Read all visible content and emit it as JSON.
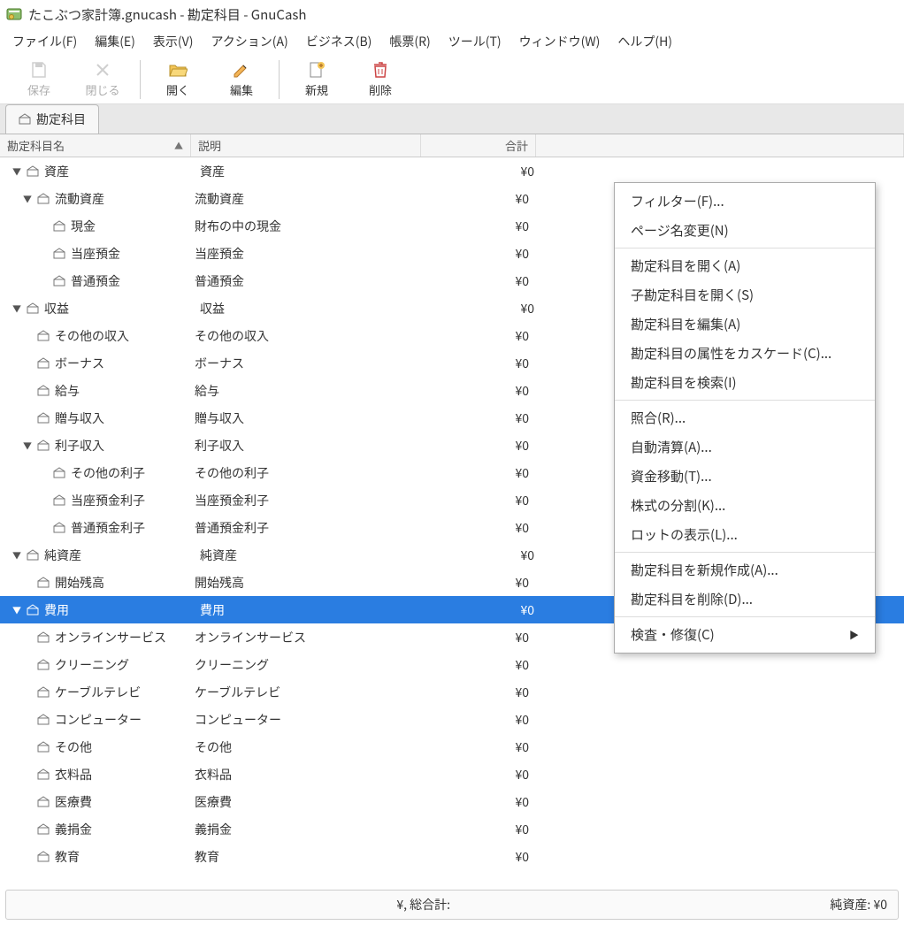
{
  "title": "たこぶつ家計簿.gnucash - 勘定科目 - GnuCash",
  "menu": {
    "file": "ファイル(F)",
    "edit": "編集(E)",
    "view": "表示(V)",
    "actions": "アクション(A)",
    "business": "ビジネス(B)",
    "reports": "帳票(R)",
    "tools": "ツール(T)",
    "windows": "ウィンドウ(W)",
    "help": "ヘルプ(H)"
  },
  "toolbar": {
    "save": "保存",
    "close": "閉じる",
    "open": "開く",
    "edit": "編集",
    "new": "新規",
    "delete": "削除"
  },
  "tab": {
    "label": "勘定科目"
  },
  "columns": {
    "name": "勘定科目名",
    "desc": "説明",
    "total": "合計"
  },
  "rows": [
    {
      "name": "資産",
      "desc": "資産",
      "total": "¥0",
      "depth": 0,
      "exp": "▼"
    },
    {
      "name": "流動資産",
      "desc": "流動資産",
      "total": "¥0",
      "depth": 1,
      "exp": "▼"
    },
    {
      "name": "現金",
      "desc": "財布の中の現金",
      "total": "¥0",
      "depth": 2,
      "exp": ""
    },
    {
      "name": "当座預金",
      "desc": "当座預金",
      "total": "¥0",
      "depth": 2,
      "exp": ""
    },
    {
      "name": "普通預金",
      "desc": "普通預金",
      "total": "¥0",
      "depth": 2,
      "exp": ""
    },
    {
      "name": "収益",
      "desc": "収益",
      "total": "¥0",
      "depth": 0,
      "exp": "▼"
    },
    {
      "name": "その他の収入",
      "desc": "その他の収入",
      "total": "¥0",
      "depth": 1,
      "exp": ""
    },
    {
      "name": "ボーナス",
      "desc": "ボーナス",
      "total": "¥0",
      "depth": 1,
      "exp": ""
    },
    {
      "name": "給与",
      "desc": "給与",
      "total": "¥0",
      "depth": 1,
      "exp": ""
    },
    {
      "name": "贈与収入",
      "desc": "贈与収入",
      "total": "¥0",
      "depth": 1,
      "exp": ""
    },
    {
      "name": "利子収入",
      "desc": "利子収入",
      "total": "¥0",
      "depth": 1,
      "exp": "▼"
    },
    {
      "name": "その他の利子",
      "desc": "その他の利子",
      "total": "¥0",
      "depth": 2,
      "exp": ""
    },
    {
      "name": "当座預金利子",
      "desc": "当座預金利子",
      "total": "¥0",
      "depth": 2,
      "exp": ""
    },
    {
      "name": "普通預金利子",
      "desc": "普通預金利子",
      "total": "¥0",
      "depth": 2,
      "exp": ""
    },
    {
      "name": "純資産",
      "desc": "純資産",
      "total": "¥0",
      "depth": 0,
      "exp": "▼"
    },
    {
      "name": "開始残高",
      "desc": "開始残高",
      "total": "¥0",
      "depth": 1,
      "exp": ""
    },
    {
      "name": "費用",
      "desc": "費用",
      "total": "¥0",
      "depth": 0,
      "exp": "▼",
      "selected": true
    },
    {
      "name": "オンラインサービス",
      "desc": "オンラインサービス",
      "total": "¥0",
      "depth": 1,
      "exp": ""
    },
    {
      "name": "クリーニング",
      "desc": "クリーニング",
      "total": "¥0",
      "depth": 1,
      "exp": ""
    },
    {
      "name": "ケーブルテレビ",
      "desc": "ケーブルテレビ",
      "total": "¥0",
      "depth": 1,
      "exp": ""
    },
    {
      "name": "コンピューター",
      "desc": "コンピューター",
      "total": "¥0",
      "depth": 1,
      "exp": ""
    },
    {
      "name": "その他",
      "desc": "その他",
      "total": "¥0",
      "depth": 1,
      "exp": ""
    },
    {
      "name": "衣料品",
      "desc": "衣料品",
      "total": "¥0",
      "depth": 1,
      "exp": ""
    },
    {
      "name": "医療費",
      "desc": "医療費",
      "total": "¥0",
      "depth": 1,
      "exp": ""
    },
    {
      "name": "義捐金",
      "desc": "義捐金",
      "total": "¥0",
      "depth": 1,
      "exp": ""
    },
    {
      "name": "教育",
      "desc": "教育",
      "total": "¥0",
      "depth": 1,
      "exp": ""
    }
  ],
  "status": {
    "left": "¥, 総合計:",
    "right": "純資産: ¥0"
  },
  "context_menu": [
    {
      "label": "フィルター(F)...",
      "type": "item"
    },
    {
      "label": "ページ名変更(N)",
      "type": "item"
    },
    {
      "type": "sep"
    },
    {
      "label": "勘定科目を開く(A)",
      "type": "item"
    },
    {
      "label": "子勘定科目を開く(S)",
      "type": "item"
    },
    {
      "label": "勘定科目を編集(A)",
      "type": "item"
    },
    {
      "label": "勘定科目の属性をカスケード(C)...",
      "type": "item"
    },
    {
      "label": "勘定科目を検索(I)",
      "type": "item"
    },
    {
      "type": "sep"
    },
    {
      "label": "照合(R)...",
      "type": "item"
    },
    {
      "label": "自動清算(A)...",
      "type": "item"
    },
    {
      "label": "資金移動(T)...",
      "type": "item"
    },
    {
      "label": "株式の分割(K)...",
      "type": "item"
    },
    {
      "label": "ロットの表示(L)...",
      "type": "item"
    },
    {
      "type": "sep"
    },
    {
      "label": "勘定科目を新規作成(A)...",
      "type": "item"
    },
    {
      "label": "勘定科目を削除(D)...",
      "type": "item"
    },
    {
      "type": "sep"
    },
    {
      "label": "検査・修復(C)",
      "type": "item",
      "submenu": true
    }
  ]
}
